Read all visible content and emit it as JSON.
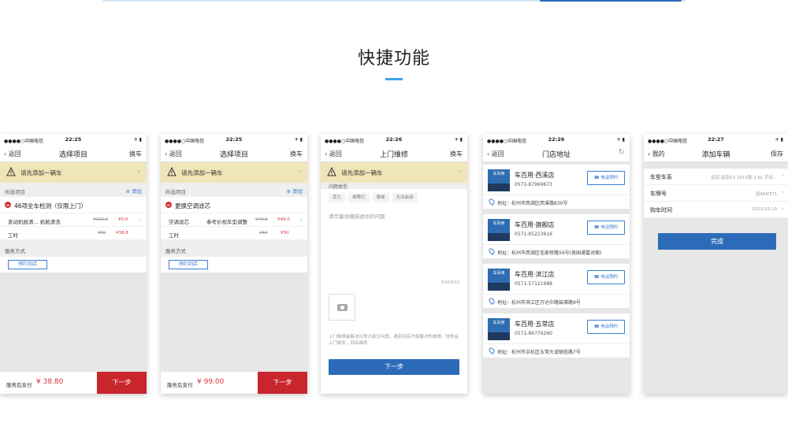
{
  "section": {
    "title": "快捷功能"
  },
  "colors": {
    "accent": "#3aa6e8",
    "danger": "#c9252d",
    "primary": "#2c6bb7",
    "notice": "#f0e5b8"
  },
  "phones": [
    {
      "status": {
        "carrier": "●●●●○中国电信 ",
        "time": "22:25",
        "battery": "✈ ▮"
      },
      "nav": {
        "back": "‹ 返回",
        "title": "选择项目",
        "right": "换车"
      },
      "notice": "请先添加一辆车",
      "selected_label": "所选项目",
      "add_label": "⊕ 添加",
      "item_title": "46项全车检测（仅限上门）",
      "rows": [
        {
          "name": "发动机舱清... 机舱清洗",
          "mid": "",
          "orig": "¥150.0",
          "price": "¥0.0"
        },
        {
          "name": "工时",
          "mid": "",
          "orig": "¥80",
          "price": "¥38.8"
        }
      ],
      "service_label": "服务方式",
      "service_btn": "预约到店",
      "footer": {
        "label": "服务后支付",
        "amount": "¥ 38.80",
        "next": "下一步"
      }
    },
    {
      "status": {
        "carrier": "●●●●○中国电信 ",
        "time": "22:25",
        "battery": "✈ ▮"
      },
      "nav": {
        "back": "‹ 返回",
        "title": "选择项目",
        "right": "换车"
      },
      "notice": "请先添加一辆车",
      "selected_label": "所选项目",
      "add_label": "⊕ 添加",
      "item_title": "更换空调滤芯",
      "rows": [
        {
          "name": "空调滤芯",
          "mid": "参考价视车型调整",
          "orig": "¥79.0",
          "price": "¥49.0"
        },
        {
          "name": "工时",
          "mid": "",
          "orig": "¥50",
          "price": "¥50"
        }
      ],
      "service_label": "服务方式",
      "service_btn": "预约到店",
      "footer": {
        "label": "服务后支付",
        "amount": "¥ 99.00",
        "next": "下一步"
      }
    },
    {
      "status": {
        "carrier": "●●●●○中国电信 ",
        "time": "22:26",
        "battery": "✈ ▮"
      },
      "nav": {
        "back": "‹ 返回",
        "title": "上门维修",
        "right": "换车"
      },
      "notice": "请先添加一辆车",
      "qtype_label": "问题类型",
      "tags": [
        "其它",
        "故障灯",
        "事故",
        "无法启动"
      ],
      "placeholder": "请尽量详细描述你的问题",
      "counter": "500/500",
      "hint": "上门维修能解决日常大部分问题，遇到到店才能解决的故障，技师会上门接车，到店维修",
      "button": "下一步"
    },
    {
      "status": {
        "carrier": "●●●●○中国电信 ",
        "time": "22:26",
        "battery": "✈ ▮"
      },
      "nav": {
        "back": "‹ 返回",
        "title": "门店地址",
        "right": "↻"
      },
      "thumb_text": "车百用",
      "call_label": "☎ 电话预约",
      "stores": [
        {
          "name": "车百用·西溪店",
          "phone": "0571-87969673",
          "address": "地址：杭州市西湖区西溪路830号"
        },
        {
          "name": "车百用·旗舰店",
          "phone": "0571-85223616",
          "address": "地址：杭州市西湖区毛家桥路59号(美国通富对面)"
        },
        {
          "name": "车百用·滨江店",
          "phone": "0571-57121688",
          "address": "地址：杭州市滨江区万达中路装璜路9号"
        },
        {
          "name": "车百用·五常店",
          "phone": "0571-86776260",
          "address": "地址：杭州市余杭区五常大道联胜路7号"
        }
      ]
    },
    {
      "status": {
        "carrier": "●●●●○中国电信 ",
        "time": "22:27",
        "battery": "✈ ▮"
      },
      "nav": {
        "back": "‹ 我的",
        "title": "添加车辆",
        "right": "保存"
      },
      "fields": [
        {
          "key": "车型车系",
          "value": "起亚 起亚K3 2015款 1.6L 手动..."
        },
        {
          "key": "车牌号",
          "value": "浙A6NT71"
        },
        {
          "key": "购车时间",
          "value": "2013-03-19"
        }
      ],
      "button": "完成"
    }
  ]
}
